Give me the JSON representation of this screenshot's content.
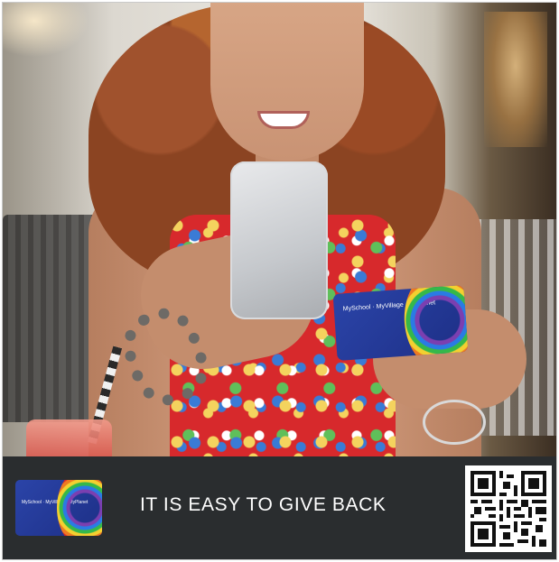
{
  "photo": {
    "subject": "woman-using-phone-with-card-icon"
  },
  "card": {
    "brand_text": "MySchool · MyVillage · MyPlanet",
    "accent_colors": [
      "#d8262d",
      "#ee7a22",
      "#f3d030",
      "#35b84a",
      "#2a7be4",
      "#7b3fb0"
    ],
    "card_color": "#2b44a8"
  },
  "banner": {
    "tagline": "IT IS EASY TO GIVE BACK",
    "background": "#2a2d2f",
    "qr_icon": "qr-code-icon"
  }
}
